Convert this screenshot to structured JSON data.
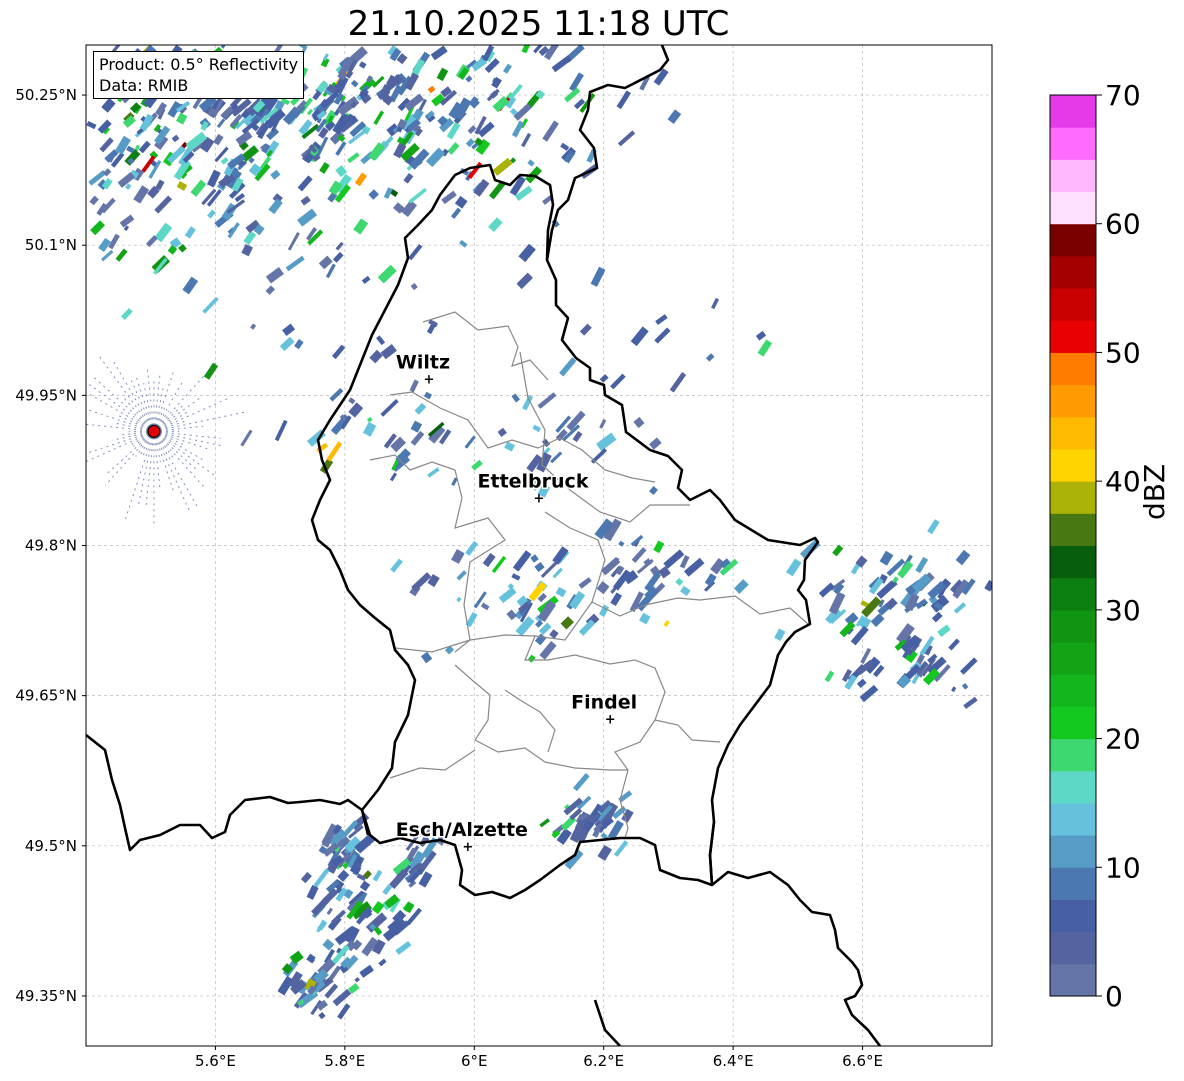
{
  "title": "21.10.2025 11:18 UTC",
  "info": {
    "product": "Product: 0.5° Reflectivity",
    "data": "Data: RMIB"
  },
  "map": {
    "lon_range": [
      5.4,
      6.8
    ],
    "lat_range": [
      49.3,
      50.3
    ],
    "x_ticks": [
      {
        "lon": 5.6,
        "label": "5.6°E"
      },
      {
        "lon": 5.8,
        "label": "5.8°E"
      },
      {
        "lon": 6.0,
        "label": "6°E"
      },
      {
        "lon": 6.2,
        "label": "6.2°E"
      },
      {
        "lon": 6.4,
        "label": "6.4°E"
      },
      {
        "lon": 6.6,
        "label": "6.6°E"
      }
    ],
    "y_ticks": [
      {
        "lat": 50.25,
        "label": "50.25°N"
      },
      {
        "lat": 50.1,
        "label": "50.1°N"
      },
      {
        "lat": 49.95,
        "label": "49.95°N"
      },
      {
        "lat": 49.8,
        "label": "49.8°N"
      },
      {
        "lat": 49.65,
        "label": "49.65°N"
      },
      {
        "lat": 49.5,
        "label": "49.5°N"
      },
      {
        "lat": 49.35,
        "label": "49.35°N"
      }
    ],
    "cities": [
      {
        "name": "Wiltz",
        "lon": 5.93,
        "lat": 49.967
      },
      {
        "name": "Ettelbruck",
        "lon": 6.1,
        "lat": 49.848
      },
      {
        "name": "Findel",
        "lon": 6.21,
        "lat": 49.627
      },
      {
        "name": "Esch/Alzette",
        "lon": 5.99,
        "lat": 49.5
      }
    ],
    "radar_site": {
      "lon": 5.505,
      "lat": 49.914,
      "color": "#e00000"
    },
    "border_color": "#000000",
    "canton_color": "#888888"
  },
  "colorbar": {
    "label": "dBZ",
    "min": 0,
    "max": 70,
    "ticks": [
      "0",
      "10",
      "20",
      "30",
      "40",
      "50",
      "60",
      "70"
    ],
    "colors": [
      "#6575a8",
      "#5464a0",
      "#4660a3",
      "#4b78b0",
      "#579cc6",
      "#66c2dc",
      "#5dd8c6",
      "#3dd870",
      "#13c81f",
      "#13b61d",
      "#12a415",
      "#109412",
      "#0b7f0f",
      "#075f0e",
      "#477812",
      "#abb208",
      "#ffd400",
      "#ffba00",
      "#ff9a00",
      "#ff7c00",
      "#e80000",
      "#c80000",
      "#a40000",
      "#7a0000",
      "#ffe0ff",
      "#ffb8ff",
      "#ff6aff",
      "#e53ae8"
    ]
  }
}
